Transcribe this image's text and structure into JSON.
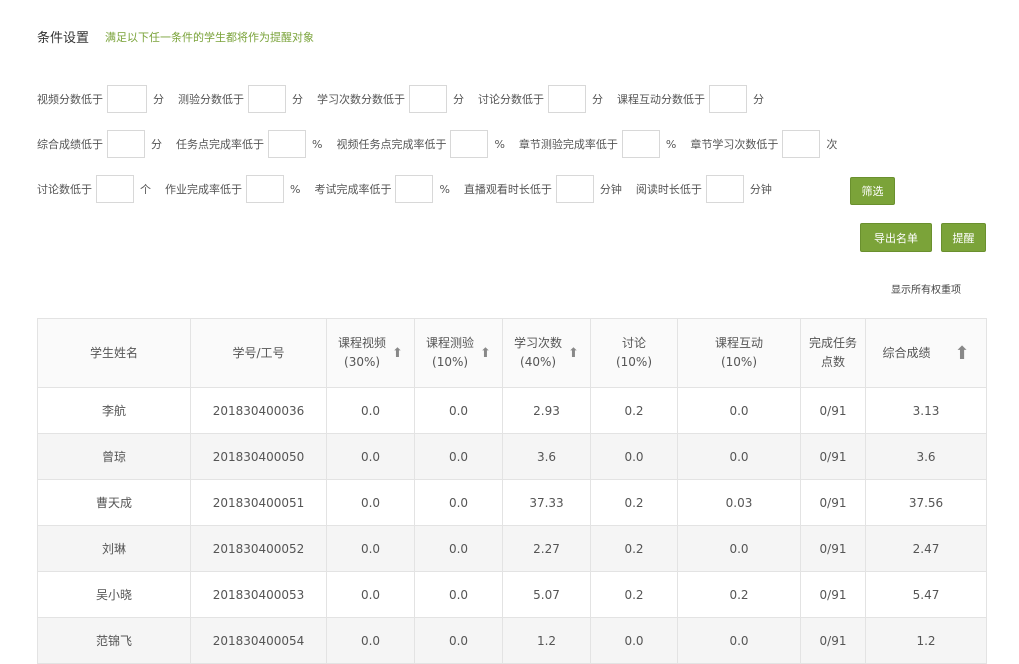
{
  "header": {
    "title": "条件设置",
    "hint": "满足以下任一条件的学生都将作为提醒对象"
  },
  "filters": {
    "row1": [
      {
        "label": "视频分数低于",
        "unit": "分"
      },
      {
        "label": "测验分数低于",
        "unit": "分"
      },
      {
        "label": "学习次数分数低于",
        "unit": "分"
      },
      {
        "label": "讨论分数低于",
        "unit": "分"
      },
      {
        "label": "课程互动分数低于",
        "unit": "分"
      }
    ],
    "row2": [
      {
        "label": "综合成绩低于",
        "unit": "分"
      },
      {
        "label": "任务点完成率低于",
        "unit": "%"
      },
      {
        "label": "视频任务点完成率低于",
        "unit": "%"
      },
      {
        "label": "章节测验完成率低于",
        "unit": "%"
      },
      {
        "label": "章节学习次数低于",
        "unit": "次"
      }
    ],
    "row3": [
      {
        "label": "讨论数低于",
        "unit": "个"
      },
      {
        "label": "作业完成率低于",
        "unit": "%"
      },
      {
        "label": "考试完成率低于",
        "unit": "%"
      },
      {
        "label": "直播观看时长低于",
        "unit": "分钟"
      },
      {
        "label": "阅读时长低于",
        "unit": "分钟"
      }
    ],
    "filter_button": "筛选"
  },
  "actions": {
    "export": "导出名单",
    "remind": "提醒",
    "show_weights": "显示所有权重项"
  },
  "table": {
    "headers": {
      "name": "学生姓名",
      "id": "学号/工号",
      "video_1": "课程视频",
      "video_2": "(30%)",
      "quiz_1": "课程测验",
      "quiz_2": "(10%)",
      "study_1": "学习次数",
      "study_2": "(40%)",
      "discuss_1": "讨论",
      "discuss_2": "(10%)",
      "interact_1": "课程互动",
      "interact_2": "(10%)",
      "tasks_1": "完成任务",
      "tasks_2": "点数",
      "total": "综合成绩"
    },
    "rows": [
      {
        "name": "李航",
        "id": "201830400036",
        "video": "0.0",
        "quiz": "0.0",
        "study": "2.93",
        "discuss": "0.2",
        "interact": "0.0",
        "tasks": "0/91",
        "total": "3.13"
      },
      {
        "name": "曾琼",
        "id": "201830400050",
        "video": "0.0",
        "quiz": "0.0",
        "study": "3.6",
        "discuss": "0.0",
        "interact": "0.0",
        "tasks": "0/91",
        "total": "3.6"
      },
      {
        "name": "曹天成",
        "id": "201830400051",
        "video": "0.0",
        "quiz": "0.0",
        "study": "37.33",
        "discuss": "0.2",
        "interact": "0.03",
        "tasks": "0/91",
        "total": "37.56"
      },
      {
        "name": "刘琳",
        "id": "201830400052",
        "video": "0.0",
        "quiz": "0.0",
        "study": "2.27",
        "discuss": "0.2",
        "interact": "0.0",
        "tasks": "0/91",
        "total": "2.47"
      },
      {
        "name": "吴小晓",
        "id": "201830400053",
        "video": "0.0",
        "quiz": "0.0",
        "study": "5.07",
        "discuss": "0.2",
        "interact": "0.2",
        "tasks": "0/91",
        "total": "5.47"
      },
      {
        "name": "范锦飞",
        "id": "201830400054",
        "video": "0.0",
        "quiz": "0.0",
        "study": "1.2",
        "discuss": "0.0",
        "interact": "0.0",
        "tasks": "0/91",
        "total": "1.2"
      }
    ]
  },
  "colors": {
    "accent": "#7ba339",
    "hint": "#7aa33a"
  }
}
